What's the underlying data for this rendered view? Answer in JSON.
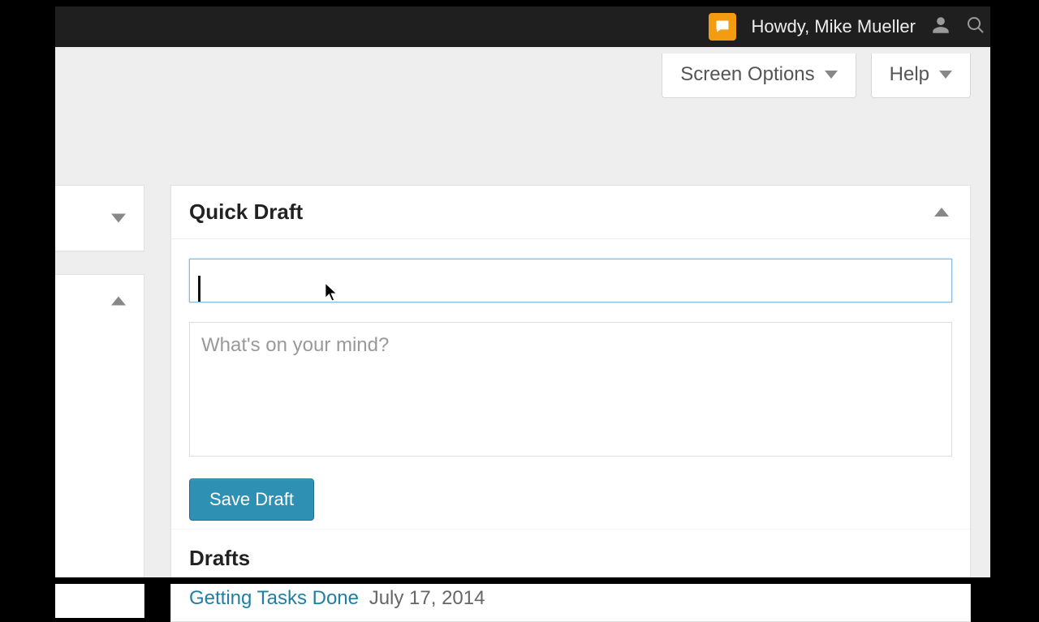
{
  "adminbar": {
    "greeting": "Howdy, Mike Mueller"
  },
  "tabs": {
    "screen_options": "Screen Options",
    "help": "Help"
  },
  "quick_draft": {
    "title": "Quick Draft",
    "title_value": "",
    "content_placeholder": "What's on your mind?",
    "save_label": "Save Draft"
  },
  "drafts": {
    "heading": "Drafts",
    "items": [
      {
        "title": "Getting Tasks Done",
        "date": "July 17, 2014"
      }
    ]
  }
}
